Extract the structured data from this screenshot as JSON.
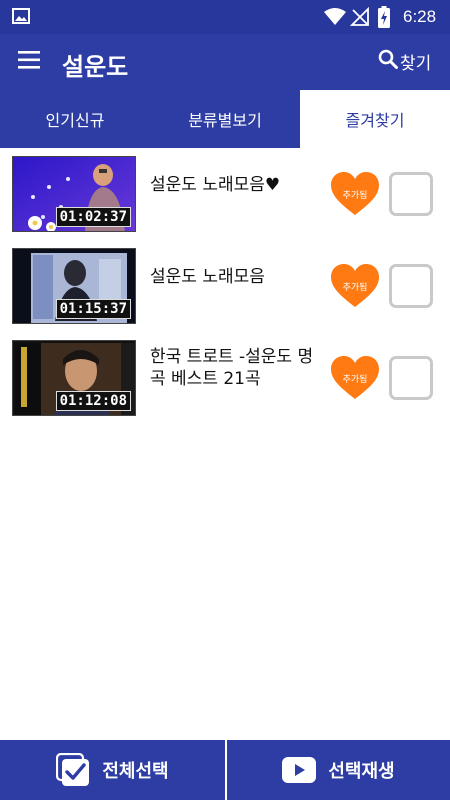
{
  "status_bar": {
    "time": "6:28",
    "icons": [
      "gallery-icon",
      "wifi-icon",
      "signal-off-icon",
      "battery-charging-icon"
    ]
  },
  "app_bar": {
    "title": "설운도",
    "search_label": "찾기"
  },
  "tabs": [
    {
      "label": "인기신규",
      "active": false
    },
    {
      "label": "분류별보기",
      "active": false
    },
    {
      "label": "즐겨찾기",
      "active": true
    }
  ],
  "videos": [
    {
      "title": "설운도 노래모음♥",
      "duration": "01:02:37",
      "badge": "추가됨"
    },
    {
      "title": "설운도 노래모음",
      "duration": "01:15:37",
      "badge": "추가됨"
    },
    {
      "title": "한국 트로트 -설운도 명곡 베스트 21곡",
      "duration": "01:12:08",
      "badge": "추가됨"
    }
  ],
  "bottom_bar": {
    "select_all_label": "전체선택",
    "play_selected_label": "선택재생"
  },
  "colors": {
    "primary": "#2e3da3",
    "status_bar": "#28379b",
    "heart": "#ff7a12",
    "checkbox_border": "#c9c9c9"
  }
}
